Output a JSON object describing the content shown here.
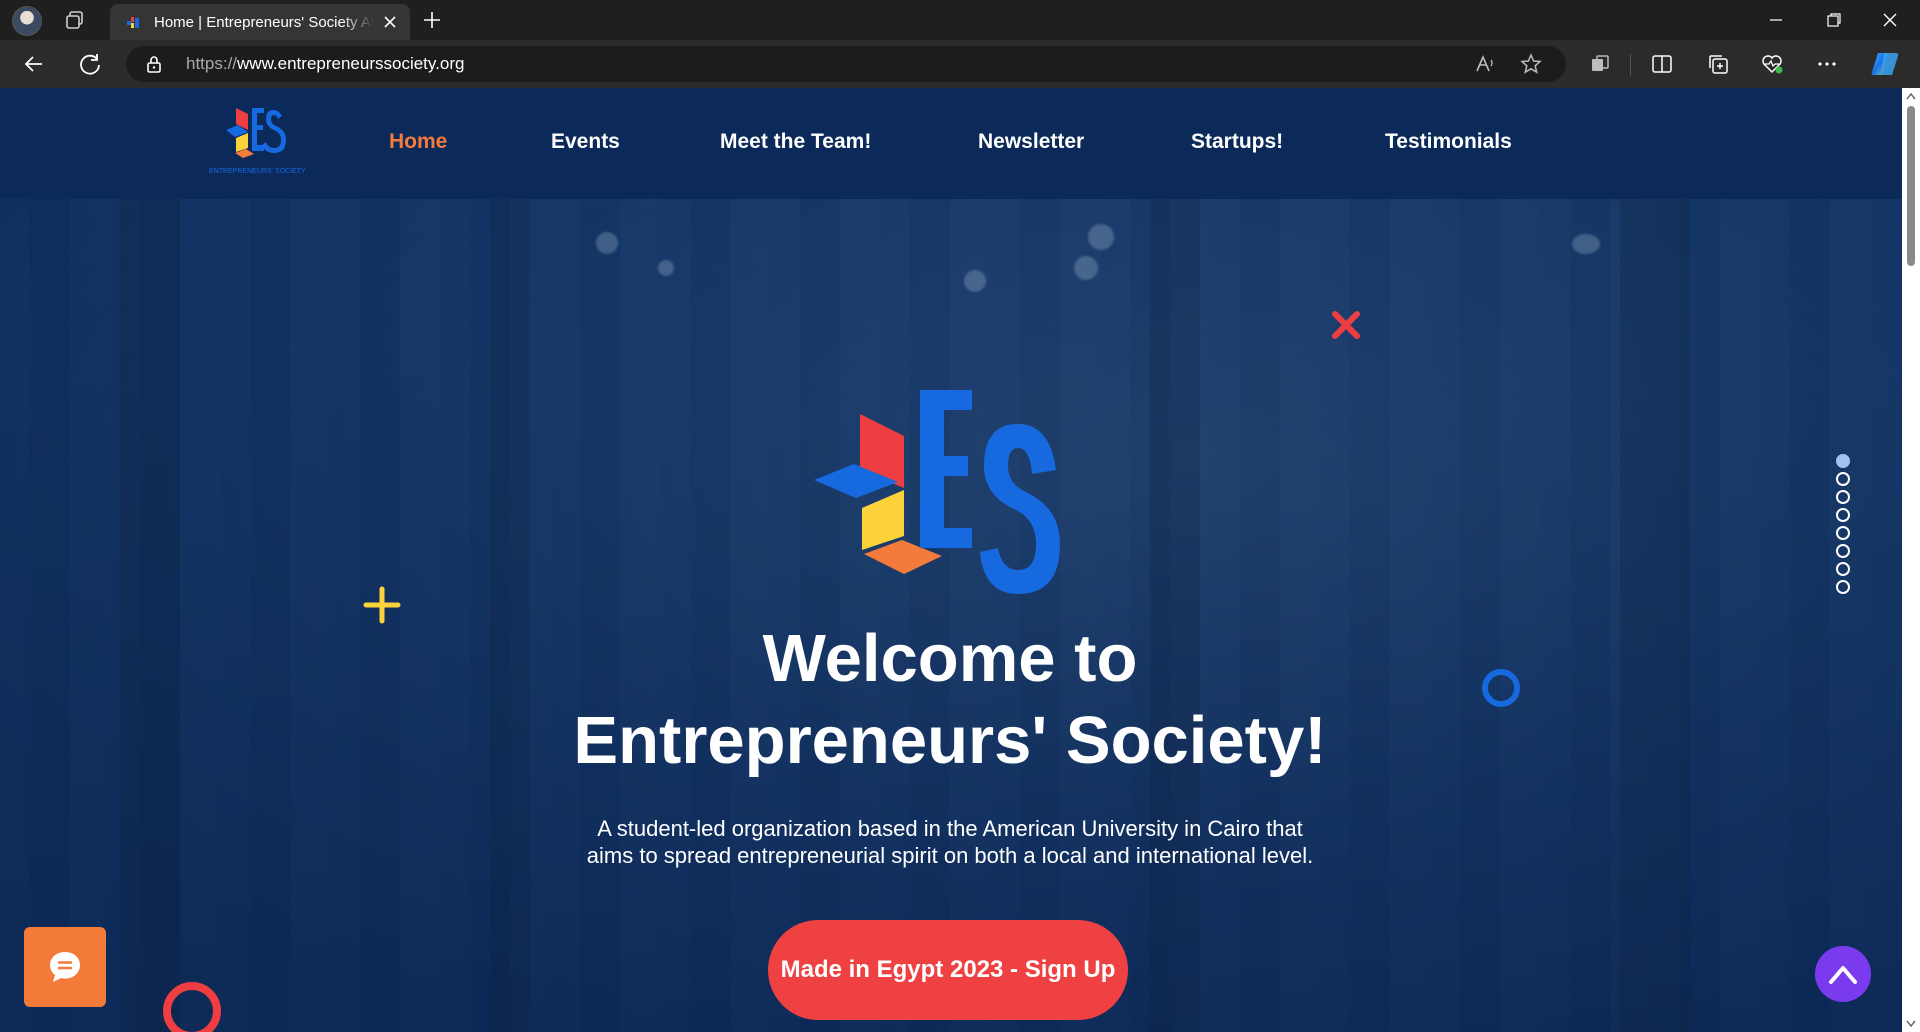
{
  "browser": {
    "tab_title": "Home | Entrepreneurs' Society AUC",
    "url_scheme": "https://",
    "url_host": "www.entrepreneurssociety.org"
  },
  "site": {
    "logo_text": "ENTREPRENEURS' SOCIETY",
    "nav": [
      {
        "label": "Home",
        "active": true
      },
      {
        "label": "Events"
      },
      {
        "label": "Meet the Team!"
      },
      {
        "label": "Newsletter"
      },
      {
        "label": "Startups!"
      },
      {
        "label": "Testimonials"
      }
    ]
  },
  "hero": {
    "title_line1": "Welcome to",
    "title_line2": "Entrepreneurs' Society!",
    "subtitle_line1": "A student-led organization based in the American University in Cairo that",
    "subtitle_line2": "aims to spread entrepreneurial spirit on both a local and international level.",
    "cta_label": "Made in Egypt 2023 - Sign Up"
  },
  "slider": {
    "total": 8,
    "active_index": 0
  },
  "colors": {
    "nav_bg": "#0b2a5a",
    "active_nav": "#f47b3b",
    "cta": "#ef4142",
    "chat": "#f47a3a",
    "to_top": "#7a3bef",
    "logo_blue": "#1769e0",
    "logo_red": "#ef3e41",
    "logo_yellow": "#fcd23a",
    "logo_orange": "#f47b3b"
  },
  "icons": {
    "chat": "chat-bubble-icon",
    "to_top": "chevron-up-icon",
    "deco_x": "x-shape-icon",
    "deco_plus": "plus-shape-icon"
  }
}
